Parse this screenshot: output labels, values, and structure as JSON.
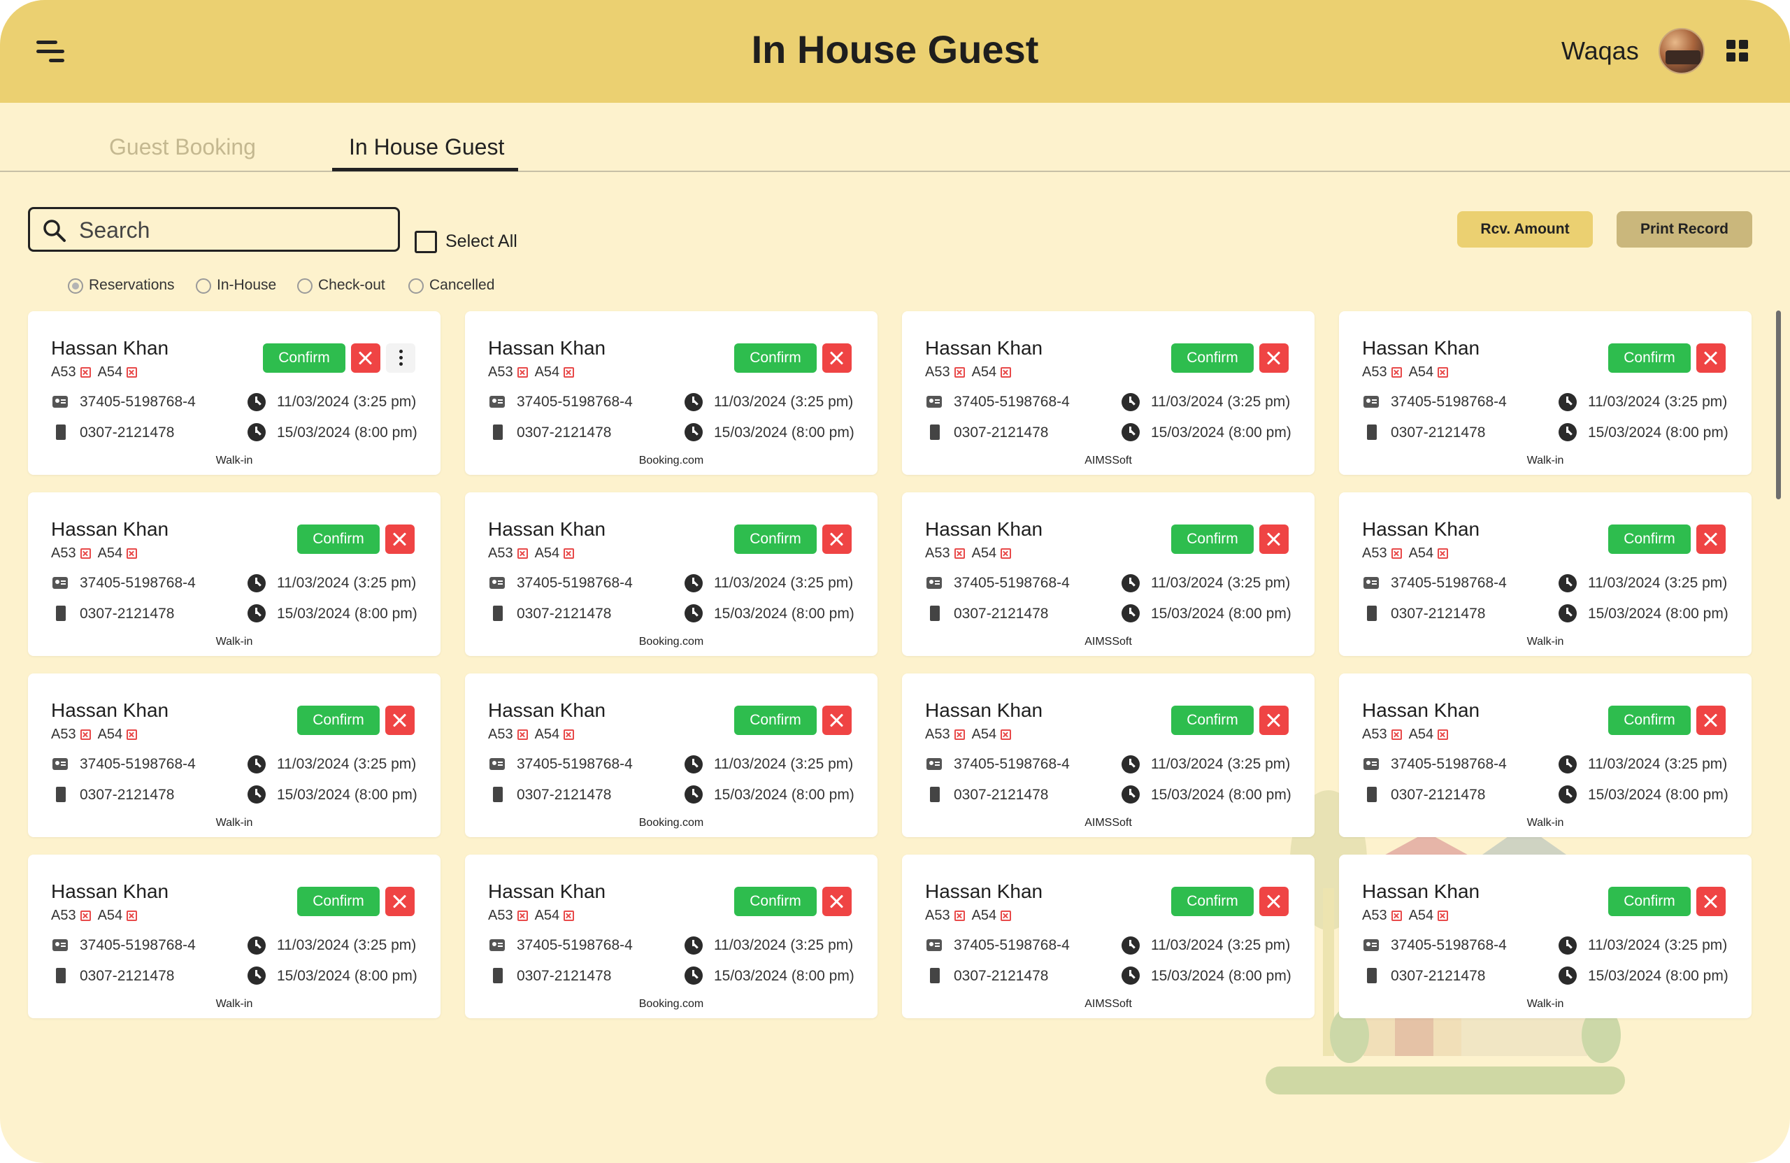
{
  "header": {
    "title": "In House Guest",
    "user_name": "Waqas",
    "menu_icon": "hamburger-menu-icon",
    "apps_icon": "apps-grid-icon"
  },
  "tabs": [
    {
      "label": "Guest Booking",
      "active": false
    },
    {
      "label": "In House Guest",
      "active": true
    }
  ],
  "search": {
    "placeholder": "Search",
    "value": ""
  },
  "select_all_label": "Select All",
  "actions": {
    "rcv_amount": "Rcv. Amount",
    "print_record": "Print Record"
  },
  "filters": [
    {
      "label": "Reservations",
      "selected": true
    },
    {
      "label": "In-House",
      "selected": false
    },
    {
      "label": "Check-out",
      "selected": false
    },
    {
      "label": "Cancelled",
      "selected": false
    }
  ],
  "colors": {
    "header_bg": "#ebd071",
    "page_bg": "#fdf2cd",
    "confirm_green": "#2ebd4e",
    "cancel_red": "#ef4444",
    "rcv_button": "#ebd071",
    "print_button": "#cab77c"
  },
  "cards": [
    {
      "name": "Hassan Khan",
      "rooms": [
        "A53",
        "A54"
      ],
      "id_number": "37405-5198768-4",
      "phone": "0307-2121478",
      "check_in": "11/03/2024 (3:25 pm)",
      "check_out": "15/03/2024 (8:00 pm)",
      "source": "Walk-in",
      "confirm_label": "Confirm",
      "has_more_menu": true
    },
    {
      "name": "Hassan Khan",
      "rooms": [
        "A53",
        "A54"
      ],
      "id_number": "37405-5198768-4",
      "phone": "0307-2121478",
      "check_in": "11/03/2024 (3:25 pm)",
      "check_out": "15/03/2024 (8:00 pm)",
      "source": "Booking.com",
      "confirm_label": "Confirm",
      "has_more_menu": false
    },
    {
      "name": "Hassan Khan",
      "rooms": [
        "A53",
        "A54"
      ],
      "id_number": "37405-5198768-4",
      "phone": "0307-2121478",
      "check_in": "11/03/2024 (3:25 pm)",
      "check_out": "15/03/2024 (8:00 pm)",
      "source": "AIMSSoft",
      "confirm_label": "Confirm",
      "has_more_menu": false
    },
    {
      "name": "Hassan Khan",
      "rooms": [
        "A53",
        "A54"
      ],
      "id_number": "37405-5198768-4",
      "phone": "0307-2121478",
      "check_in": "11/03/2024 (3:25 pm)",
      "check_out": "15/03/2024 (8:00 pm)",
      "source": "Walk-in",
      "confirm_label": "Confirm",
      "has_more_menu": false
    },
    {
      "name": "Hassan Khan",
      "rooms": [
        "A53",
        "A54"
      ],
      "id_number": "37405-5198768-4",
      "phone": "0307-2121478",
      "check_in": "11/03/2024 (3:25 pm)",
      "check_out": "15/03/2024 (8:00 pm)",
      "source": "Walk-in",
      "confirm_label": "Confirm",
      "has_more_menu": false
    },
    {
      "name": "Hassan Khan",
      "rooms": [
        "A53",
        "A54"
      ],
      "id_number": "37405-5198768-4",
      "phone": "0307-2121478",
      "check_in": "11/03/2024 (3:25 pm)",
      "check_out": "15/03/2024 (8:00 pm)",
      "source": "Booking.com",
      "confirm_label": "Confirm",
      "has_more_menu": false
    },
    {
      "name": "Hassan Khan",
      "rooms": [
        "A53",
        "A54"
      ],
      "id_number": "37405-5198768-4",
      "phone": "0307-2121478",
      "check_in": "11/03/2024 (3:25 pm)",
      "check_out": "15/03/2024 (8:00 pm)",
      "source": "AIMSSoft",
      "confirm_label": "Confirm",
      "has_more_menu": false
    },
    {
      "name": "Hassan Khan",
      "rooms": [
        "A53",
        "A54"
      ],
      "id_number": "37405-5198768-4",
      "phone": "0307-2121478",
      "check_in": "11/03/2024 (3:25 pm)",
      "check_out": "15/03/2024 (8:00 pm)",
      "source": "Walk-in",
      "confirm_label": "Confirm",
      "has_more_menu": false
    },
    {
      "name": "Hassan Khan",
      "rooms": [
        "A53",
        "A54"
      ],
      "id_number": "37405-5198768-4",
      "phone": "0307-2121478",
      "check_in": "11/03/2024 (3:25 pm)",
      "check_out": "15/03/2024 (8:00 pm)",
      "source": "Walk-in",
      "confirm_label": "Confirm",
      "has_more_menu": false
    },
    {
      "name": "Hassan Khan",
      "rooms": [
        "A53",
        "A54"
      ],
      "id_number": "37405-5198768-4",
      "phone": "0307-2121478",
      "check_in": "11/03/2024 (3:25 pm)",
      "check_out": "15/03/2024 (8:00 pm)",
      "source": "Booking.com",
      "confirm_label": "Confirm",
      "has_more_menu": false
    },
    {
      "name": "Hassan Khan",
      "rooms": [
        "A53",
        "A54"
      ],
      "id_number": "37405-5198768-4",
      "phone": "0307-2121478",
      "check_in": "11/03/2024 (3:25 pm)",
      "check_out": "15/03/2024 (8:00 pm)",
      "source": "AIMSSoft",
      "confirm_label": "Confirm",
      "has_more_menu": false
    },
    {
      "name": "Hassan Khan",
      "rooms": [
        "A53",
        "A54"
      ],
      "id_number": "37405-5198768-4",
      "phone": "0307-2121478",
      "check_in": "11/03/2024 (3:25 pm)",
      "check_out": "15/03/2024 (8:00 pm)",
      "source": "Walk-in",
      "confirm_label": "Confirm",
      "has_more_menu": false
    },
    {
      "name": "Hassan Khan",
      "rooms": [
        "A53",
        "A54"
      ],
      "id_number": "37405-5198768-4",
      "phone": "0307-2121478",
      "check_in": "11/03/2024 (3:25 pm)",
      "check_out": "15/03/2024 (8:00 pm)",
      "source": "Walk-in",
      "confirm_label": "Confirm",
      "has_more_menu": false
    },
    {
      "name": "Hassan Khan",
      "rooms": [
        "A53",
        "A54"
      ],
      "id_number": "37405-5198768-4",
      "phone": "0307-2121478",
      "check_in": "11/03/2024 (3:25 pm)",
      "check_out": "15/03/2024 (8:00 pm)",
      "source": "Booking.com",
      "confirm_label": "Confirm",
      "has_more_menu": false
    },
    {
      "name": "Hassan Khan",
      "rooms": [
        "A53",
        "A54"
      ],
      "id_number": "37405-5198768-4",
      "phone": "0307-2121478",
      "check_in": "11/03/2024 (3:25 pm)",
      "check_out": "15/03/2024 (8:00 pm)",
      "source": "AIMSSoft",
      "confirm_label": "Confirm",
      "has_more_menu": false
    },
    {
      "name": "Hassan Khan",
      "rooms": [
        "A53",
        "A54"
      ],
      "id_number": "37405-5198768-4",
      "phone": "0307-2121478",
      "check_in": "11/03/2024 (3:25 pm)",
      "check_out": "15/03/2024 (8:00 pm)",
      "source": "Walk-in",
      "confirm_label": "Confirm",
      "has_more_menu": false
    }
  ]
}
